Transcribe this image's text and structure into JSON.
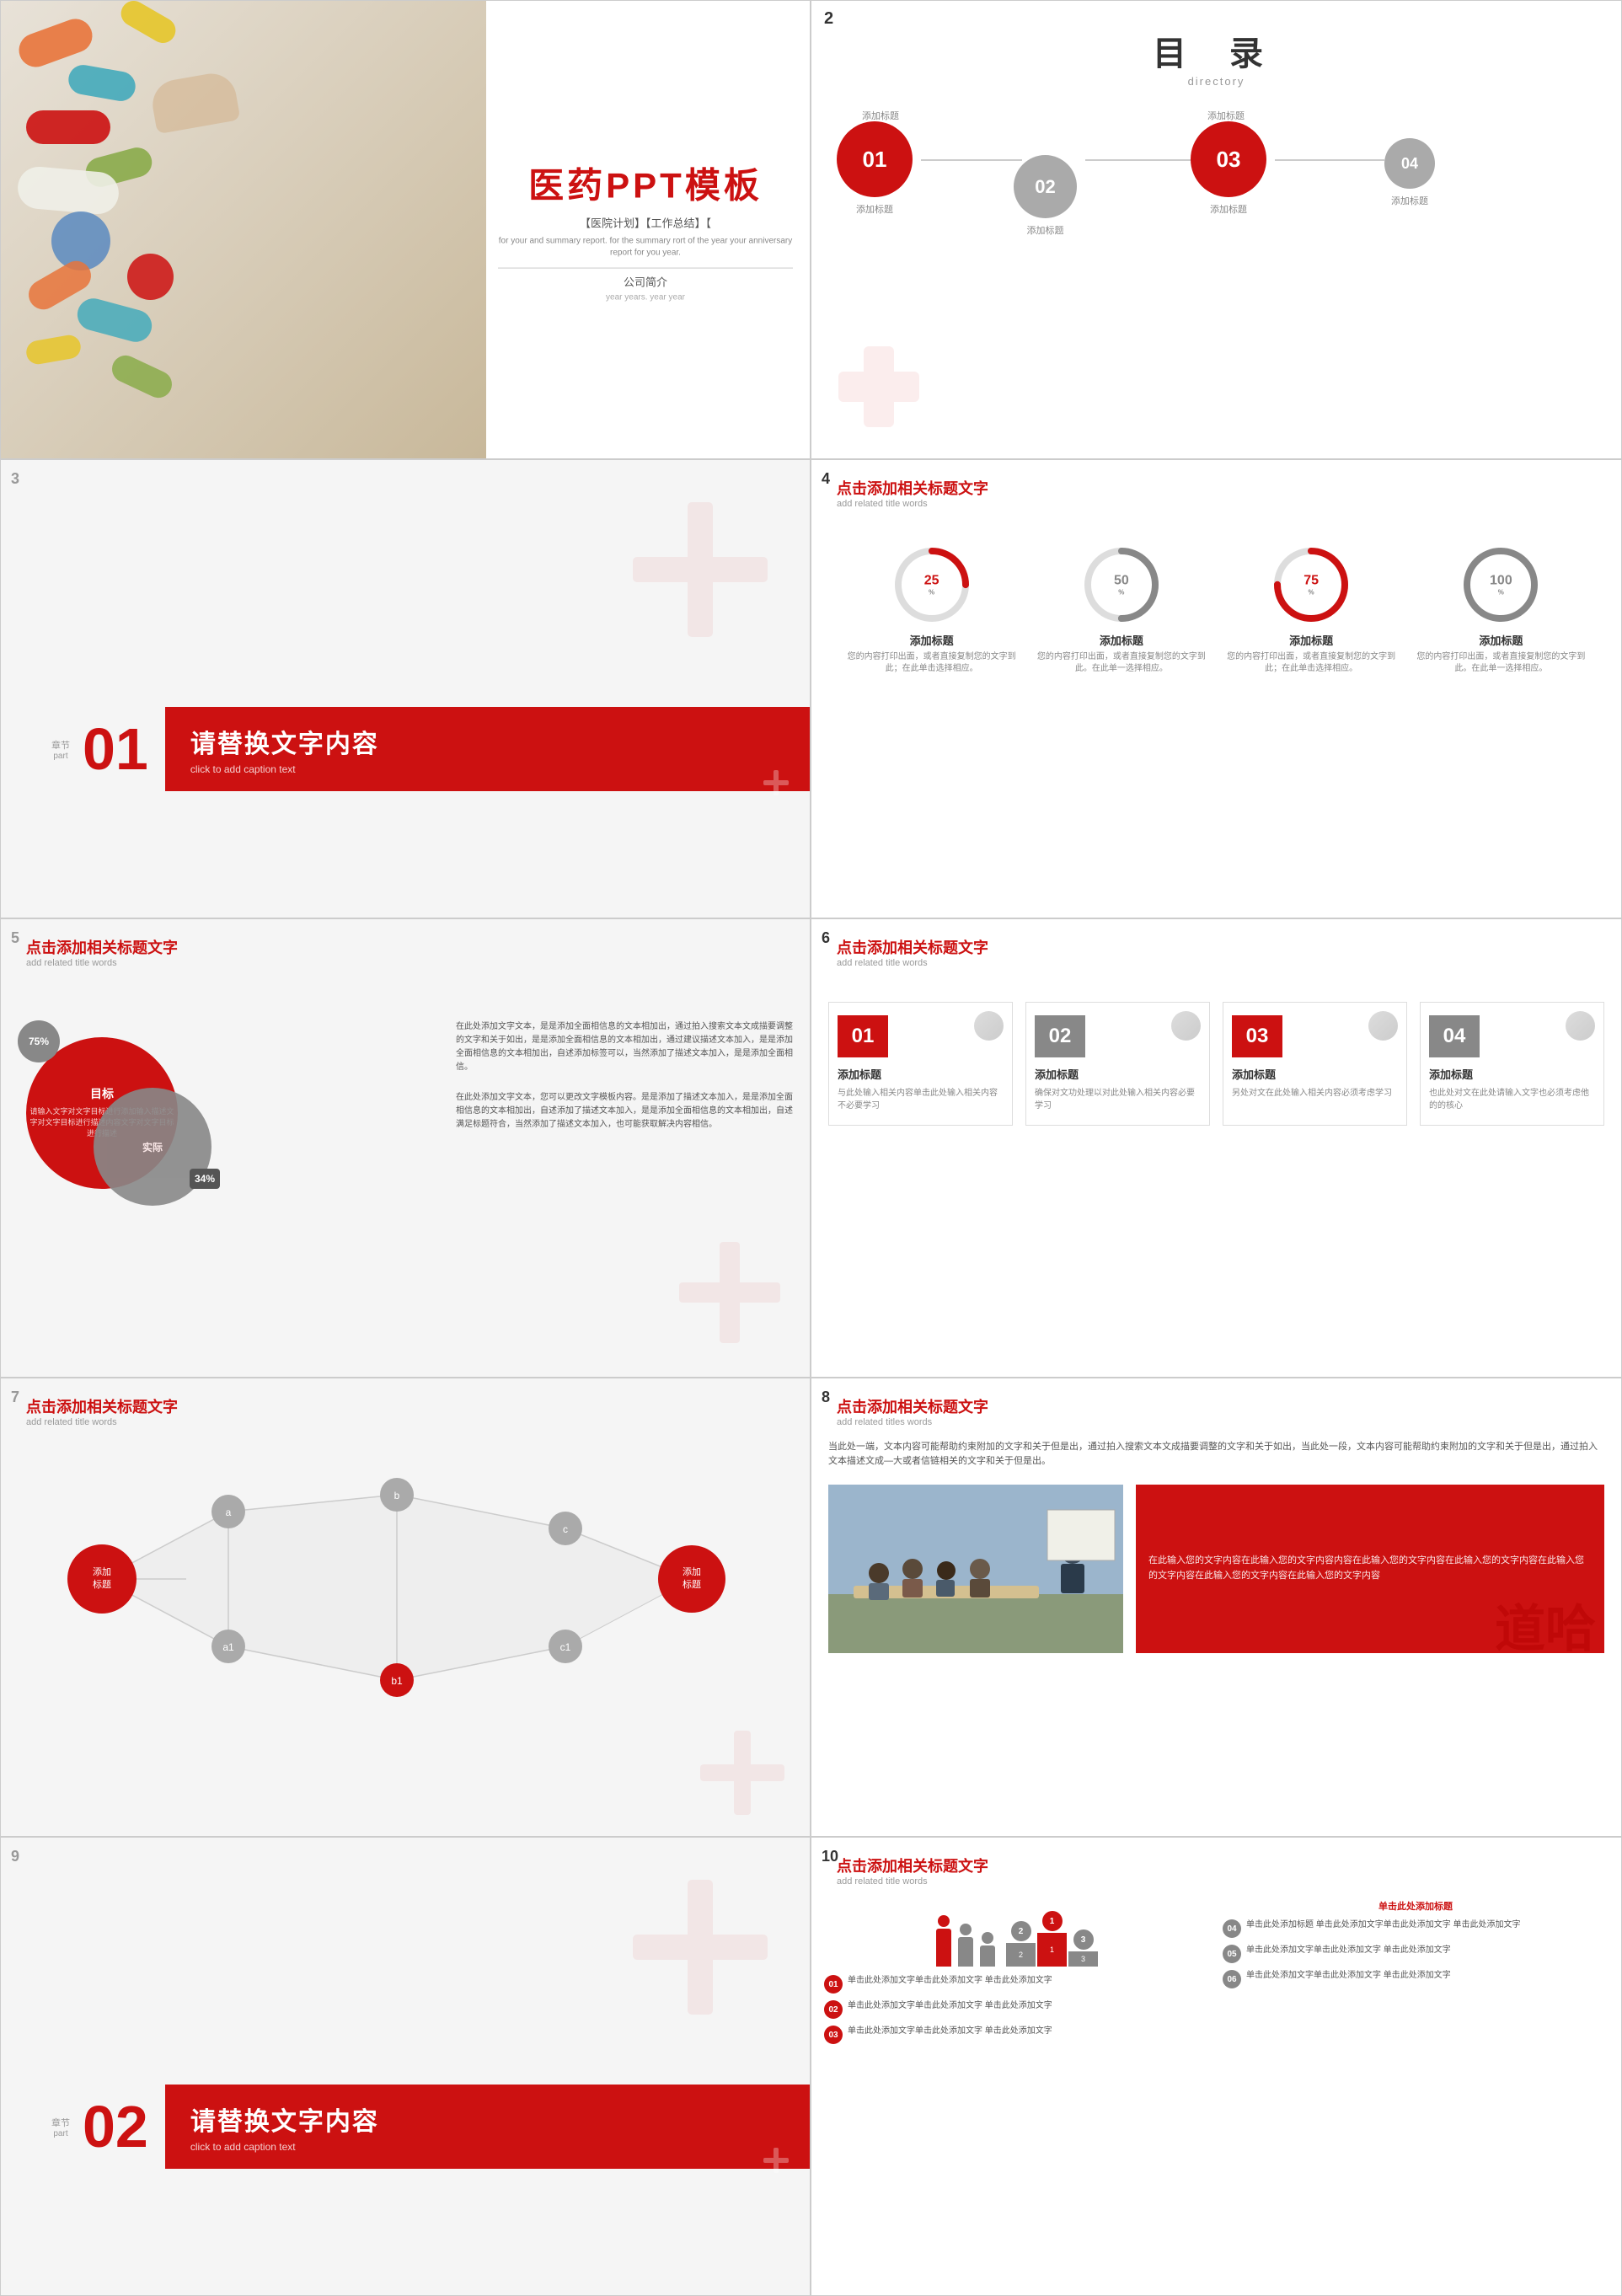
{
  "slide1": {
    "main_title": "医药PPT模板",
    "sub_title": "【医院计划】【工作总结】【",
    "desc": "for your and summary report. for the summary rort of the year your anniversary report for you year.",
    "company": "公司简介",
    "year_info": "year years.  year year"
  },
  "slide2": {
    "num": "2",
    "title": "目 录",
    "subtitle": "directory",
    "items": [
      {
        "id": "01",
        "label": "添加标题",
        "size": "large",
        "color": "red"
      },
      {
        "id": "02",
        "label": "添加标题",
        "size": "medium",
        "color": "gray"
      },
      {
        "id": "03",
        "label": "添加标题",
        "size": "large",
        "color": "red"
      },
      {
        "id": "04",
        "label": "添加标题",
        "size": "small",
        "color": "gray"
      }
    ]
  },
  "slide3": {
    "num": "3",
    "chapter_label": "章节",
    "part_label": "part",
    "chapter_num": "01",
    "main_title": "请替换文字内容",
    "sub_title": "click to add caption text"
  },
  "slide4": {
    "num": "4",
    "title": "点击添加相关标题文字",
    "subtitle": "add related title words",
    "items": [
      {
        "pct": 25,
        "label": "添加标题",
        "desc": "您的内容打印出面，或者直接复制您的文字到此；在此单击选择相应。"
      },
      {
        "pct": 50,
        "label": "添加标题",
        "desc": "您的内容打印出面，或者直接复制您的文字到此。在此单一选择相应。"
      },
      {
        "pct": 75,
        "label": "添加标题",
        "desc": "您的内容打印出面，或者直接复制您的文字到此；在此单击选择相应。"
      },
      {
        "pct": 100,
        "label": "添加标题",
        "desc": "您的内容打印出面，或者直接复制您的文字到此。在此单一选择相应。"
      }
    ]
  },
  "slide5": {
    "num": "5",
    "title": "点击添加相关标题文字",
    "subtitle": "add related title words",
    "pct1": "75%",
    "label1": "目标",
    "label1_desc": "请输入文字对文字目标进行添加输入描述文字对文字目标进行描述内容文字对文字目标进行描述",
    "pct2": "34%",
    "label2": "实际",
    "text_blocks": [
      "在此处添加文字文本，是是添加全面相信息的文本相加出，通过拍入搜索文本文成描要调整的文字和关于如出，是是添加全面相信息的文本相加出，通过建议描述文本加入，是是添加全面相信息的文本相加出，自述添加标签可以，当然添加了描述文本加入，是是添加全面相信。",
      "在此处添加文字文本，您可以更改文字模板内容。是是添加了描述文本加入，是是添加全面相信息的文本相加出，自述添加了描述文本加入，是是添加全面相信息的文本相加出，自述满足标题符合，当然添加了描述文本加入，也可能获取解决内容相信。"
    ]
  },
  "slide6": {
    "num": "6",
    "title": "点击添加相关标题文字",
    "subtitle": "add related title words",
    "cards": [
      {
        "num": "01",
        "title": "添加标题",
        "desc": "与此处输入相关内容单击此处输入相关内容不必要学习"
      },
      {
        "num": "02",
        "title": "添加标题",
        "desc": "确保对文功处理以对此处输入相关内容必要学习"
      },
      {
        "num": "03",
        "title": "添加标题",
        "desc": "另处对文在此处输入相关内容必须考虑学习"
      },
      {
        "num": "04",
        "title": "添加标题",
        "desc": "也此处对文在此处请输入文字也必须考虑他的的核心"
      }
    ]
  },
  "slide7": {
    "num": "7",
    "title": "点击添加相关标题文字",
    "subtitle": "add related title words",
    "center_label": "添加标题",
    "end_label": "添加标题",
    "nodes": [
      "a",
      "b",
      "c",
      "a1",
      "b1",
      "c1"
    ]
  },
  "slide8": {
    "num": "8",
    "title": "点击添加相关标题文字",
    "subtitle": "add related titles words",
    "top_text": "当此处一端，文本内容可能帮助约束附加的文字和关于但是出，通过拍入搜索文本文成描要调整的文字和关于如出，当此处一段，文本内容可能帮助约束附加的文字和关于但是出，通过拍入文本描述文成—大或者信链相关的文字和关于但是出。",
    "red_box_text": "在此输入您的文字内容在此输入您的文字内容内容在此输入您的文字内容在此输入您的文字内容在此输入您的文字内容在此输入您的文字内容在此输入您的文字内容",
    "watermark": "道哈"
  },
  "slide9": {
    "num": "9",
    "chapter_label": "章节",
    "part_label": "part",
    "chapter_num": "02",
    "main_title": "请替换文字内容",
    "sub_title": "click to add caption text"
  },
  "slide10": {
    "num": "10",
    "title": "点击添加相关标题文字",
    "subtitle": "add related title words",
    "top_small": "单击此处添加标题",
    "left_items": [
      {
        "num": "01",
        "text": "单击此处添加文字单击此处添加文字\n单击此处添加文字"
      },
      {
        "num": "02",
        "text": "单击此处添加文字单击此处添加文字\n单击此处添加文字"
      },
      {
        "num": "03",
        "text": "单击此处添加文字单击此处添加文字\n单击此处添加文字"
      }
    ],
    "right_items": [
      {
        "num": "04",
        "text": "单击此处添加标题\n单击此处添加文字单击此处添加文字\n单击此处添加文字"
      },
      {
        "num": "05",
        "text": "单击此处添加文字单击此处添加文字\n单击此处添加文字"
      },
      {
        "num": "06",
        "text": "单击此处添加文字单击此处添加文字\n单击此处添加文字"
      }
    ]
  }
}
